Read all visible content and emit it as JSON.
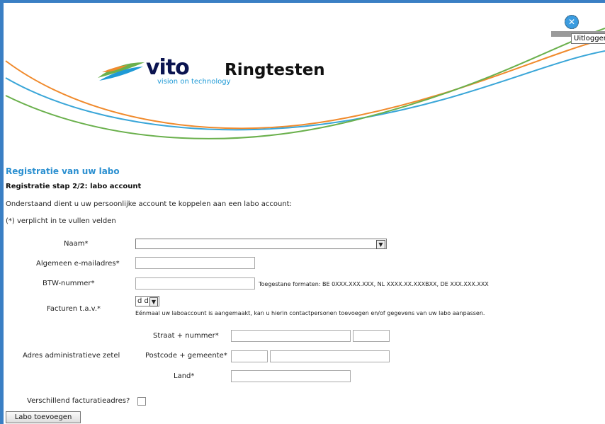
{
  "header": {
    "brand": "vito",
    "tagline": "vision on technology",
    "app_title": "Ringtesten",
    "close_glyph": "✕",
    "logout_tooltip": "Uitloggen"
  },
  "page": {
    "section_title": "Registratie van uw labo",
    "step_title": "Registratie stap 2/2: labo account",
    "info": "Onderstaand dient u uw persoonlijke account te koppelen aan een labo account:",
    "required_note": "(*) verplicht in te vullen velden"
  },
  "form": {
    "naam_label": "Naam*",
    "email_label": "Algemeen e-mailadres*",
    "btw_label": "BTW-nummer*",
    "btw_hint": "Toegestane formaten: BE 0XXX.XXX.XXX, NL XXXX.XX.XXXBXX, DE XXX.XXX.XXX",
    "facturen_label": "Facturen t.a.v.*",
    "facturen_value": "d d",
    "facturen_hint": "Eénmaal uw laboaccount is aangemaakt, kan u hierin contactpersonen toevoegen en/of gegevens van uw labo aanpassen.",
    "adres_label": "Adres administratieve zetel",
    "straat_label": "Straat + nummer*",
    "postcode_label": "Postcode + gemeente*",
    "land_label": "Land*",
    "verschillend_label": "Verschillend facturatieadres?",
    "submit_label": "Labo toevoegen"
  },
  "colors": {
    "accent_blue": "#2a8fd0",
    "wave_orange": "#f08a2c",
    "wave_blue": "#3aa6d8",
    "wave_green": "#6ab04c"
  }
}
